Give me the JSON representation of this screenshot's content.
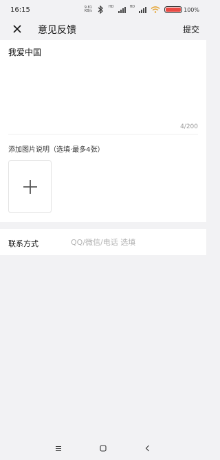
{
  "status_bar": {
    "time": "16:15",
    "net_speed": "9.81",
    "net_unit": "KB/s",
    "hd_label": "HD",
    "battery_text": "100%",
    "battery_color": "#ea4a43"
  },
  "header": {
    "title": "意见反馈",
    "submit_label": "提交",
    "close_icon": "close-icon"
  },
  "feedback": {
    "text": "我爱中国",
    "counter": "4/200"
  },
  "images": {
    "label": "添加图片说明（选填·最多4张）",
    "add_icon": "plus-icon"
  },
  "contact": {
    "label": "联系方式",
    "placeholder": "QQ/微信/电话 选填"
  },
  "nav": {
    "menu_icon": "menu-icon",
    "home_icon": "square-icon",
    "back_icon": "back-icon"
  }
}
